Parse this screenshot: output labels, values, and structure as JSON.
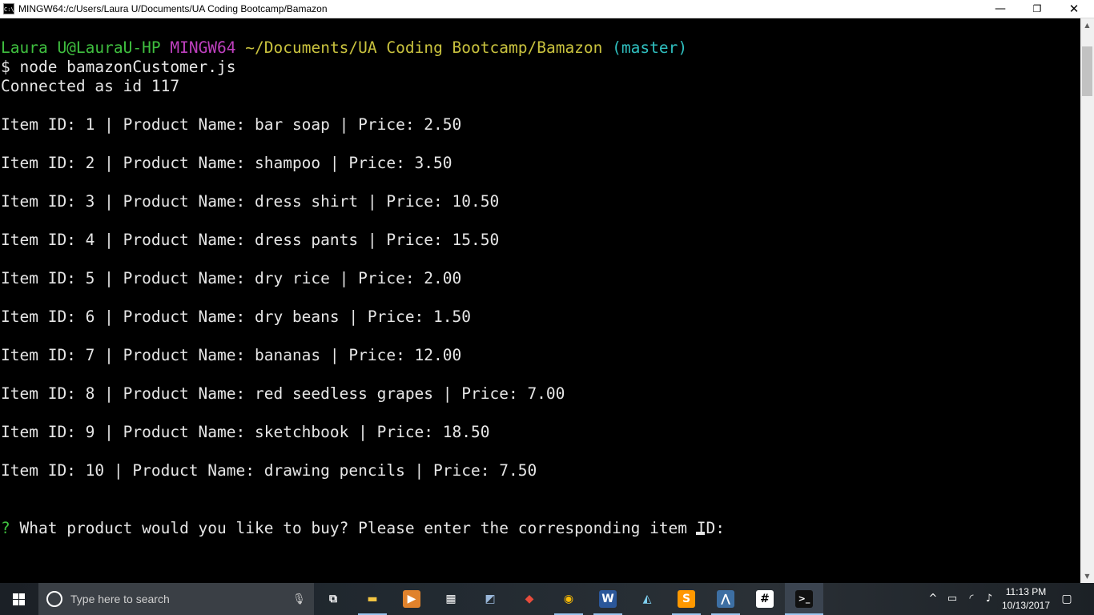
{
  "window": {
    "title": "MINGW64:/c/Users/Laura U/Documents/UA Coding Bootcamp/Bamazon",
    "icon_label": "C:\\",
    "minimize_glyph": "—",
    "maximize_glyph": "❐",
    "close_glyph": "✕"
  },
  "terminal": {
    "prompt": {
      "user_host": "Laura U@LauraU-HP",
      "shell": "MINGW64",
      "path": "~/Documents/UA Coding Bootcamp/Bamazon",
      "branch": "(master)"
    },
    "command_line": "$ node bamazonCustomer.js",
    "connected_line": "Connected as id 117",
    "items": [
      "Item ID: 1 | Product Name: bar soap | Price: 2.50",
      "Item ID: 2 | Product Name: shampoo | Price: 3.50",
      "Item ID: 3 | Product Name: dress shirt | Price: 10.50",
      "Item ID: 4 | Product Name: dress pants | Price: 15.50",
      "Item ID: 5 | Product Name: dry rice | Price: 2.00",
      "Item ID: 6 | Product Name: dry beans | Price: 1.50",
      "Item ID: 7 | Product Name: bananas | Price: 12.00",
      "Item ID: 8 | Product Name: red seedless grapes | Price: 7.00",
      "Item ID: 9 | Product Name: sketchbook | Price: 18.50",
      "Item ID: 10 | Product Name: drawing pencils | Price: 7.50"
    ],
    "question_mark": "?",
    "question": "What product would you like to buy? Please enter the corresponding item ID:",
    "input_value": ""
  },
  "scrollbar": {
    "up_glyph": "▲",
    "down_glyph": "▼"
  },
  "taskbar": {
    "search_placeholder": "Type here to search",
    "apps": [
      {
        "name": "task-view",
        "glyph": "⧉",
        "color": "#ffffff",
        "bg": "transparent"
      },
      {
        "name": "file-explorer",
        "glyph": "▬",
        "color": "#f4c542",
        "bg": "transparent"
      },
      {
        "name": "media-player",
        "glyph": "▶",
        "color": "#ffffff",
        "bg": "#e0822c"
      },
      {
        "name": "calculator",
        "glyph": "▦",
        "color": "#ffffff",
        "bg": "transparent"
      },
      {
        "name": "app-generic",
        "glyph": "◩",
        "color": "#9ab7d9",
        "bg": "transparent"
      },
      {
        "name": "git-gui",
        "glyph": "◆",
        "color": "#e74c3c",
        "bg": "transparent"
      },
      {
        "name": "chrome",
        "glyph": "◉",
        "color": "#fbbc05",
        "bg": "transparent"
      },
      {
        "name": "word",
        "glyph": "W",
        "color": "#ffffff",
        "bg": "#2b579a"
      },
      {
        "name": "app-blue",
        "glyph": "◭",
        "color": "#7fd0f0",
        "bg": "transparent"
      },
      {
        "name": "sublime-text",
        "glyph": "S",
        "color": "#ffffff",
        "bg": "#ff9800"
      },
      {
        "name": "mysql-workbench",
        "glyph": "⋀",
        "color": "#ffffff",
        "bg": "#3d6fa3"
      },
      {
        "name": "slack",
        "glyph": "#",
        "color": "#000000",
        "bg": "#ffffff"
      },
      {
        "name": "git-bash",
        "glyph": ">_",
        "color": "#ffffff",
        "bg": "#111111"
      }
    ],
    "tray": {
      "chevron": "^",
      "battery": "▭",
      "wifi": "◜",
      "volume": "♪"
    },
    "time": "11:13 PM",
    "date": "10/13/2017",
    "notification_glyph": "▢"
  },
  "colors": {
    "user_host": "#3fbf3f",
    "shell": "#bf40bf",
    "path": "#c9c23e",
    "branch": "#2fbfbf",
    "terminal_text": "#dcdcdc",
    "terminal_bg": "#000000"
  }
}
